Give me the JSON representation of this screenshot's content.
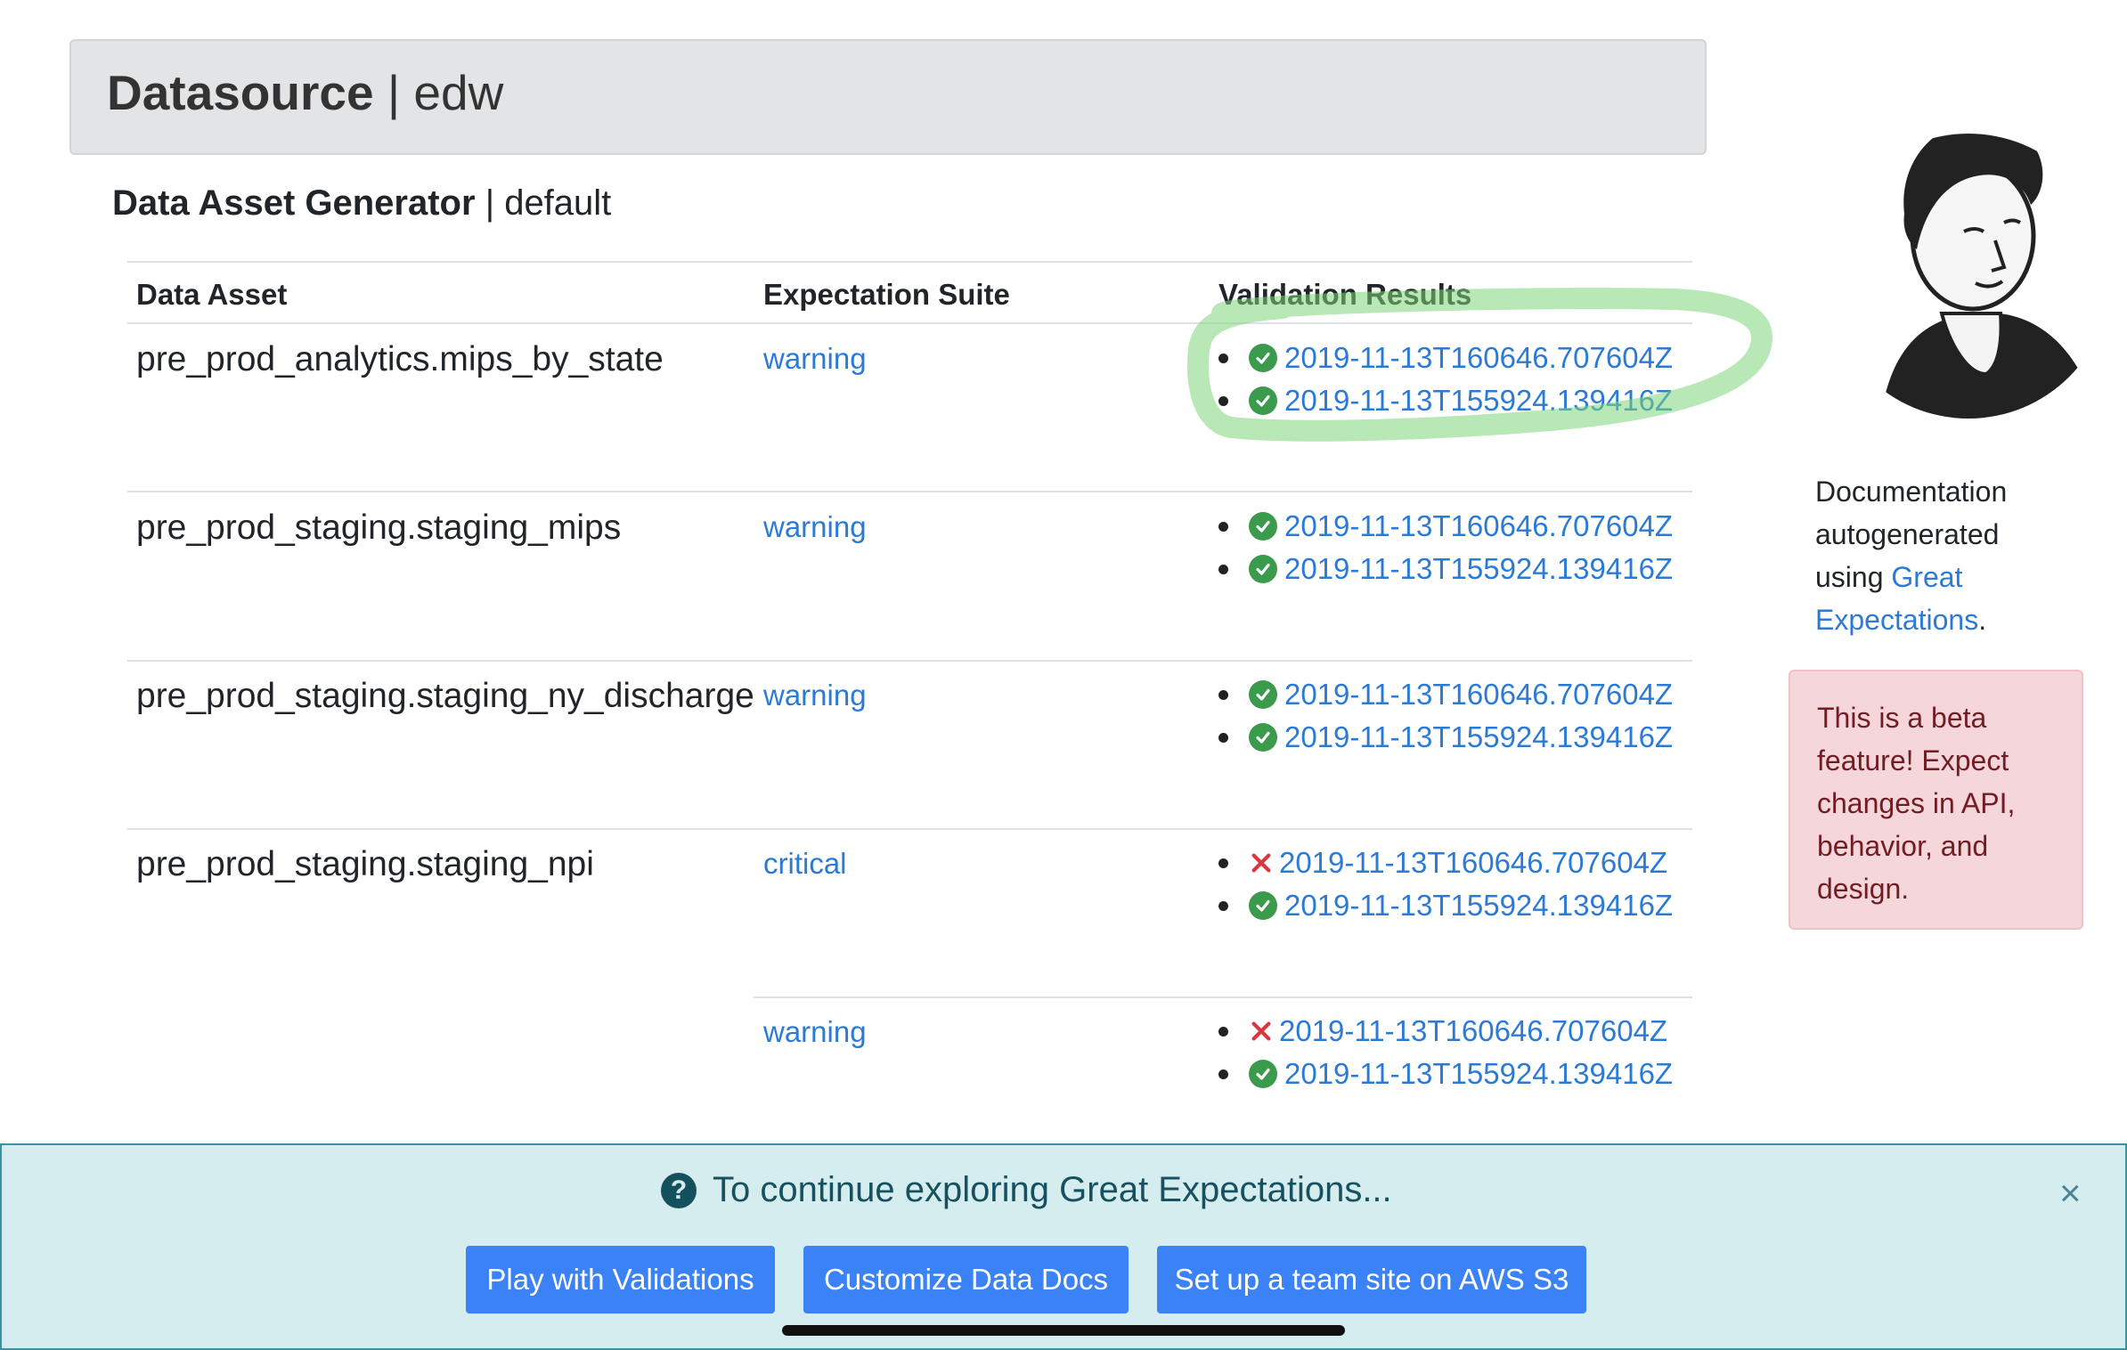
{
  "header": {
    "title_bold": "Datasource",
    "title_rest": "| edw"
  },
  "generator": {
    "title_bold": "Data Asset Generator",
    "title_rest": "| default"
  },
  "table": {
    "columns": [
      "Data Asset",
      "Expectation Suite",
      "Validation Results"
    ],
    "rows": [
      {
        "asset": "pre_prod_analytics.mips_by_state",
        "suite": "warning",
        "results": [
          {
            "status": "success",
            "label": "2019-11-13T160646.707604Z"
          },
          {
            "status": "success",
            "label": "2019-11-13T155924.139416Z"
          }
        ]
      },
      {
        "asset": "pre_prod_staging.staging_mips",
        "suite": "warning",
        "results": [
          {
            "status": "success",
            "label": "2019-11-13T160646.707604Z"
          },
          {
            "status": "success",
            "label": "2019-11-13T155924.139416Z"
          }
        ]
      },
      {
        "asset": "pre_prod_staging.staging_ny_discharge",
        "suite": "warning",
        "results": [
          {
            "status": "success",
            "label": "2019-11-13T160646.707604Z"
          },
          {
            "status": "success",
            "label": "2019-11-13T155924.139416Z"
          }
        ]
      },
      {
        "asset": "pre_prod_staging.staging_npi",
        "suite": "critical",
        "results": [
          {
            "status": "failure",
            "label": "2019-11-13T160646.707604Z"
          },
          {
            "status": "success",
            "label": "2019-11-13T155924.139416Z"
          }
        ]
      },
      {
        "asset": "",
        "suite": "warning",
        "results": [
          {
            "status": "failure",
            "label": "2019-11-13T160646.707604Z"
          },
          {
            "status": "success",
            "label": "2019-11-13T155924.139416Z"
          }
        ]
      }
    ]
  },
  "sidebar": {
    "doc_text_prefix": "Documentation autogenerated using ",
    "doc_link": "Great Expectations",
    "doc_text_suffix": ".",
    "beta_notice": "This is a beta feature! Expect changes in API, behavior, and design."
  },
  "banner": {
    "message": "To continue exploring Great Expectations...",
    "close_label": "×",
    "buttons": [
      "Play with Validations",
      "Customize Data Docs",
      "Set up a team site on AWS S3"
    ]
  },
  "colors": {
    "link": "#2b7bd6",
    "success": "#3b9b4c",
    "failure": "#d9363e",
    "banner_bg": "#d6edf0",
    "button": "#3b82f6",
    "highlight": "#7ed67a"
  },
  "icons": {
    "success": "check-circle-icon",
    "failure": "x-mark-icon",
    "help": "question-circle-icon",
    "close": "close-icon"
  }
}
